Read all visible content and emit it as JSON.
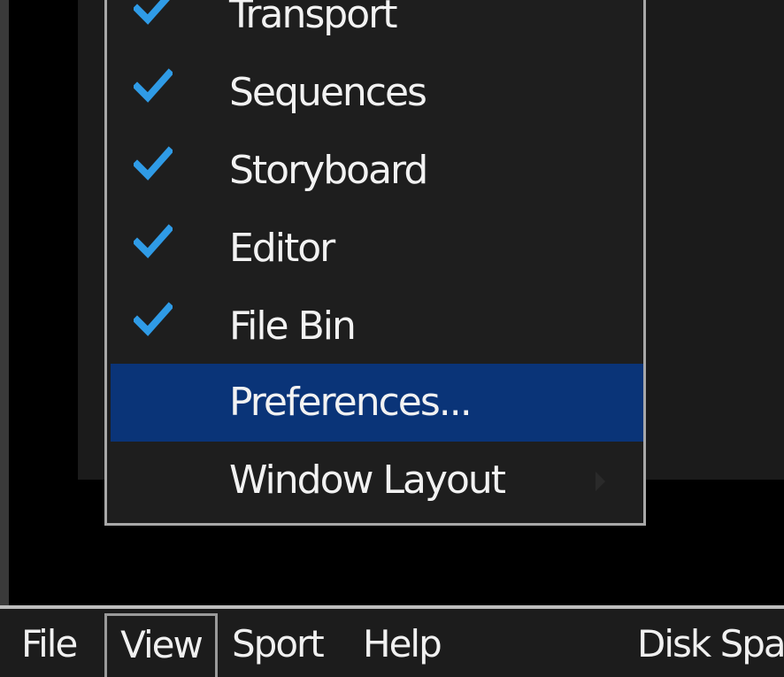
{
  "menubar": {
    "items": [
      "File",
      "View",
      "Sport",
      "Help",
      "Disk Spa"
    ]
  },
  "view_menu": {
    "items": [
      {
        "label": "Transport",
        "checked": true
      },
      {
        "label": "Sequences",
        "checked": true
      },
      {
        "label": "Storyboard",
        "checked": true
      },
      {
        "label": "Editor",
        "checked": true
      },
      {
        "label": "File Bin",
        "checked": true
      },
      {
        "label": "Preferences...",
        "checked": false,
        "highlighted": true
      },
      {
        "label": "Window Layout",
        "checked": false,
        "submenu": true
      }
    ],
    "check_icon": "checkmark-icon",
    "submenu_icon": "triangle-right-icon"
  },
  "colors": {
    "check": "#2f9be6",
    "highlight": "#0a3478",
    "menu_bg": "#1e1e1e",
    "text": "#f2f2f2"
  }
}
